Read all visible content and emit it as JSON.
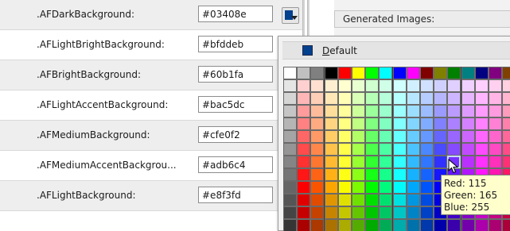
{
  "rows": [
    {
      "label": ".AFDarkBackground:",
      "value": "#03408e"
    },
    {
      "label": ".AFLightBrightBackground:",
      "value": "#bfddeb"
    },
    {
      "label": ".AFBrightBackground:",
      "value": "#60b1fa"
    },
    {
      "label": ".AFLightAccentBackground:",
      "value": "#bac5dc"
    },
    {
      "label": ".AFMediumBackground:",
      "value": "#cfe0f2"
    },
    {
      "label": ".AFMediumAccentBackgrou...",
      "value": "#adb6c4"
    },
    {
      "label": ".AFLightBackground:",
      "value": "#e8f3fd"
    }
  ],
  "swatch_button": {
    "color": "#03408e",
    "icon": "dropdown-arrow-icon"
  },
  "generated_images": {
    "title": "Generated Images:"
  },
  "color_popup": {
    "default_item": {
      "mnemonic": "D",
      "label_rest": "efault",
      "color": "#03408e"
    },
    "tooltip": {
      "red": "Red: 115",
      "green": "Green: 165",
      "blue": "Blue: 255"
    }
  }
}
